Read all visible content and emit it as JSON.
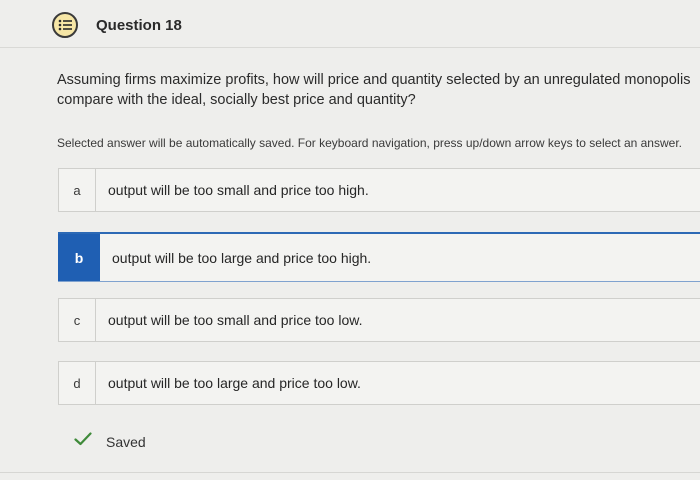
{
  "question": {
    "number_label": "Question 18",
    "icon": "list-icon",
    "prompt_line1": "Assuming firms maximize profits, how will price and quantity selected by an unregulated monopolis",
    "prompt_line2": "compare with the ideal, socially best price and quantity?"
  },
  "instructions": "Selected answer will be automatically saved. For keyboard navigation, press up/down arrow keys to select an answer.",
  "options": [
    {
      "letter": "a",
      "text": "output will be too small and price too high.",
      "selected": false
    },
    {
      "letter": "b",
      "text": "output will be too large and price too high.",
      "selected": true
    },
    {
      "letter": "c",
      "text": "output will be too small and price too low.",
      "selected": false
    },
    {
      "letter": "d",
      "text": "output will be too large and price too low.",
      "selected": false
    }
  ],
  "status": {
    "icon": "checkmark-icon",
    "label": "Saved"
  },
  "colors": {
    "selected": "#1f5fb3",
    "check": "#3f8a3a",
    "icon_bg": "#f6e6a6"
  }
}
